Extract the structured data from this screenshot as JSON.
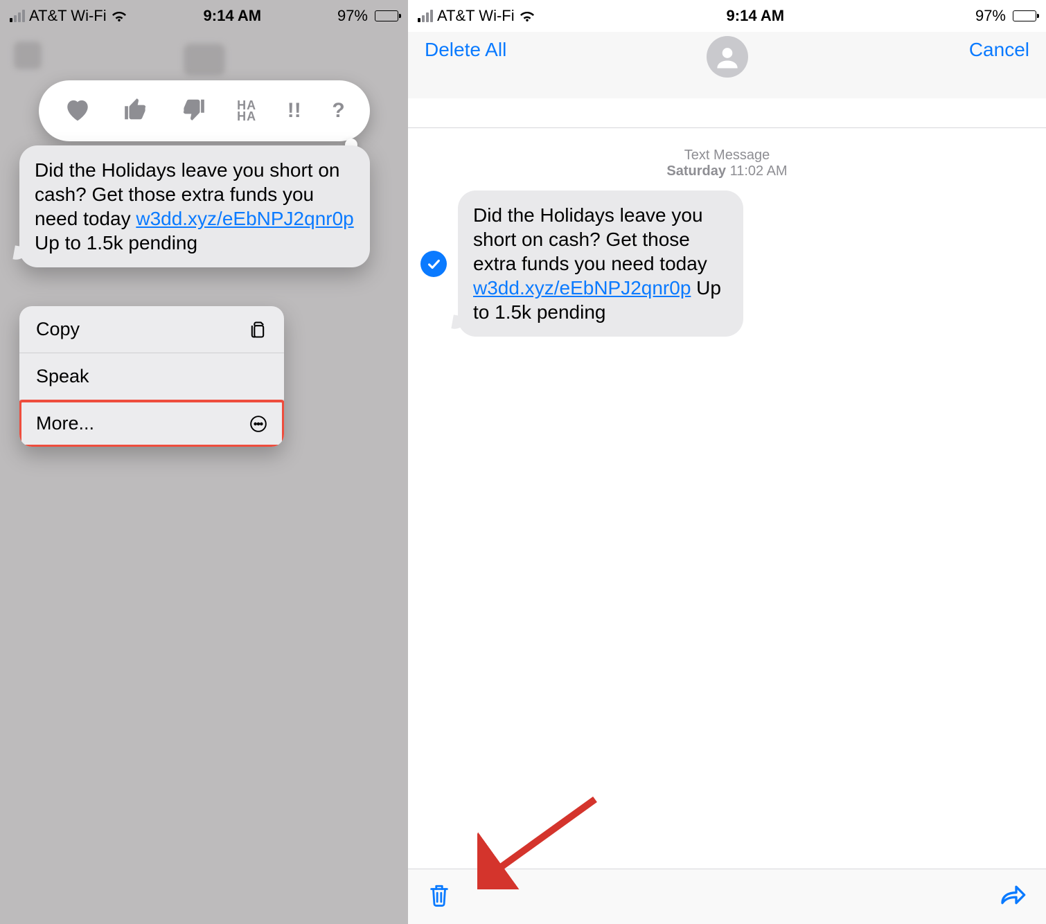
{
  "status": {
    "carrier": "AT&T Wi-Fi",
    "time": "9:14 AM",
    "battery_pct": "97%"
  },
  "message": {
    "text_pre": "Did the Holidays leave you short on cash? Get those extra funds you need today ",
    "link": "w3dd.xyz/eEbNPJ2qnr0p",
    "text_post": " Up to 1.5k pending"
  },
  "context_menu": {
    "copy": "Copy",
    "speak": "Speak",
    "more": "More..."
  },
  "right_nav": {
    "delete_all": "Delete All",
    "cancel": "Cancel"
  },
  "timestamp": {
    "label": "Text Message",
    "day": "Saturday",
    "time": "11:02 AM"
  }
}
